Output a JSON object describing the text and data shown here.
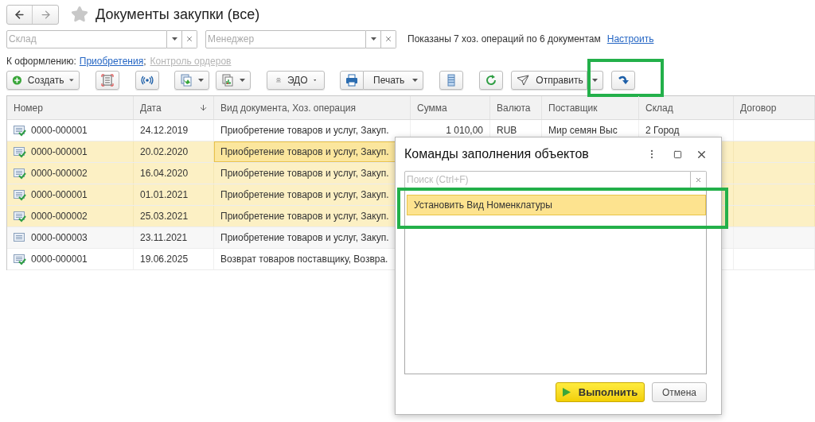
{
  "title": "Документы закупки (все)",
  "filters": [
    {
      "placeholder": "Склад"
    },
    {
      "placeholder": "Менеджер"
    }
  ],
  "summary": "Показаны 7 хоз. операций по 6 документам",
  "settings_link": "Настроить",
  "to_process": {
    "label": "К оформлению:",
    "separator": ";",
    "links": [
      {
        "text": "Приобретения",
        "disabled": false
      },
      {
        "text": "Контроль ордеров",
        "disabled": true
      }
    ]
  },
  "toolbar": [
    {
      "kind": "plus",
      "label": "Создать",
      "dropdown": true,
      "highlighted": false
    },
    {
      "kind": "barcode",
      "dropdown": false,
      "highlighted": false
    },
    {
      "kind": "broadcast",
      "dropdown": false,
      "highlighted": false
    },
    {
      "kind": "docs",
      "dropdown": true,
      "highlighted": false
    },
    {
      "kind": "report",
      "dropdown": true,
      "highlighted": false
    },
    {
      "kind": "edo",
      "label": "ЭДО",
      "dropdown": true,
      "highlighted": false
    },
    {
      "kind": "printer",
      "label": "Печать",
      "dropdown": true,
      "highlighted": false
    },
    {
      "kind": "list",
      "dropdown": false,
      "highlighted": false
    },
    {
      "kind": "refresh",
      "dropdown": false,
      "highlighted": false
    },
    {
      "kind": "send",
      "label": "Отправить",
      "dropdown": true,
      "highlighted": false
    },
    {
      "kind": "redo",
      "dropdown": false,
      "highlighted": true
    }
  ],
  "table": {
    "columns": [
      {
        "label": "Номер",
        "sorted": false,
        "kind": "text"
      },
      {
        "label": "Дата",
        "sorted": true,
        "kind": "text"
      },
      {
        "label": "Вид документа, Хоз. операция",
        "sorted": false,
        "kind": "text"
      },
      {
        "label": "Сумма",
        "sorted": false,
        "kind": "number"
      },
      {
        "label": "Валюта",
        "sorted": false,
        "kind": "text"
      },
      {
        "label": "Поставщик",
        "sorted": false,
        "kind": "text"
      },
      {
        "label": "Склад",
        "sorted": false,
        "kind": "text"
      },
      {
        "label": "Договор",
        "sorted": false,
        "kind": "text"
      }
    ],
    "rows": [
      {
        "posted": true,
        "selected": false,
        "cells": [
          {
            "text": "0000-000001",
            "focused": false
          },
          {
            "text": "24.12.2019",
            "focused": false
          },
          {
            "text": "Приобретение товаров и услуг, Закуп.",
            "focused": false
          },
          {
            "text": "1 010,00",
            "focused": false
          },
          {
            "text": "RUB",
            "focused": false
          },
          {
            "text": "Мир семян Выс",
            "focused": false
          },
          {
            "text": "2 Город",
            "focused": false
          }
        ]
      },
      {
        "posted": true,
        "selected": true,
        "cells": [
          {
            "text": "0000-000001",
            "focused": false
          },
          {
            "text": "20.02.2020",
            "focused": false
          },
          {
            "text": "Приобретение товаров и услуг, Закуп.",
            "focused": true
          }
        ]
      },
      {
        "posted": true,
        "selected": true,
        "cells": [
          {
            "text": "0000-000002",
            "focused": false
          },
          {
            "text": "16.04.2020",
            "focused": false
          },
          {
            "text": "Приобретение товаров и услуг, Закуп.",
            "focused": false
          }
        ]
      },
      {
        "posted": true,
        "selected": true,
        "cells": [
          {
            "text": "0000-000001",
            "focused": false
          },
          {
            "text": "01.01.2021",
            "focused": false
          },
          {
            "text": "Приобретение товаров и услуг, Закуп.",
            "focused": false
          }
        ]
      },
      {
        "posted": true,
        "selected": true,
        "cells": [
          {
            "text": "0000-000002",
            "focused": false
          },
          {
            "text": "25.03.2021",
            "focused": false
          },
          {
            "text": "Приобретение товаров и услуг, Закуп.",
            "focused": false
          }
        ]
      },
      {
        "posted": false,
        "selected": false,
        "cells": [
          {
            "text": "0000-000003",
            "focused": false
          },
          {
            "text": "23.11.2021",
            "focused": false
          },
          {
            "text": "Приобретение товаров и услуг, Закуп.",
            "focused": false
          }
        ]
      },
      {
        "posted": true,
        "selected": false,
        "cells": [
          {
            "text": "0000-000001",
            "focused": false
          },
          {
            "text": "19.06.2025",
            "focused": false
          },
          {
            "text": "Возврат товаров поставщику, Возвра.",
            "focused": false
          }
        ]
      }
    ]
  },
  "dialog": {
    "title": "Команды заполнения объектов",
    "search": {
      "placeholder": "Поиск (Ctrl+F)"
    },
    "items": [
      {
        "text": "Установить Вид Номенклатуры",
        "selected": true,
        "highlighted": true
      }
    ],
    "buttons": [
      {
        "label": "Выполнить",
        "kind": "primary"
      },
      {
        "label": "Отмена",
        "kind": "secondary"
      }
    ]
  }
}
